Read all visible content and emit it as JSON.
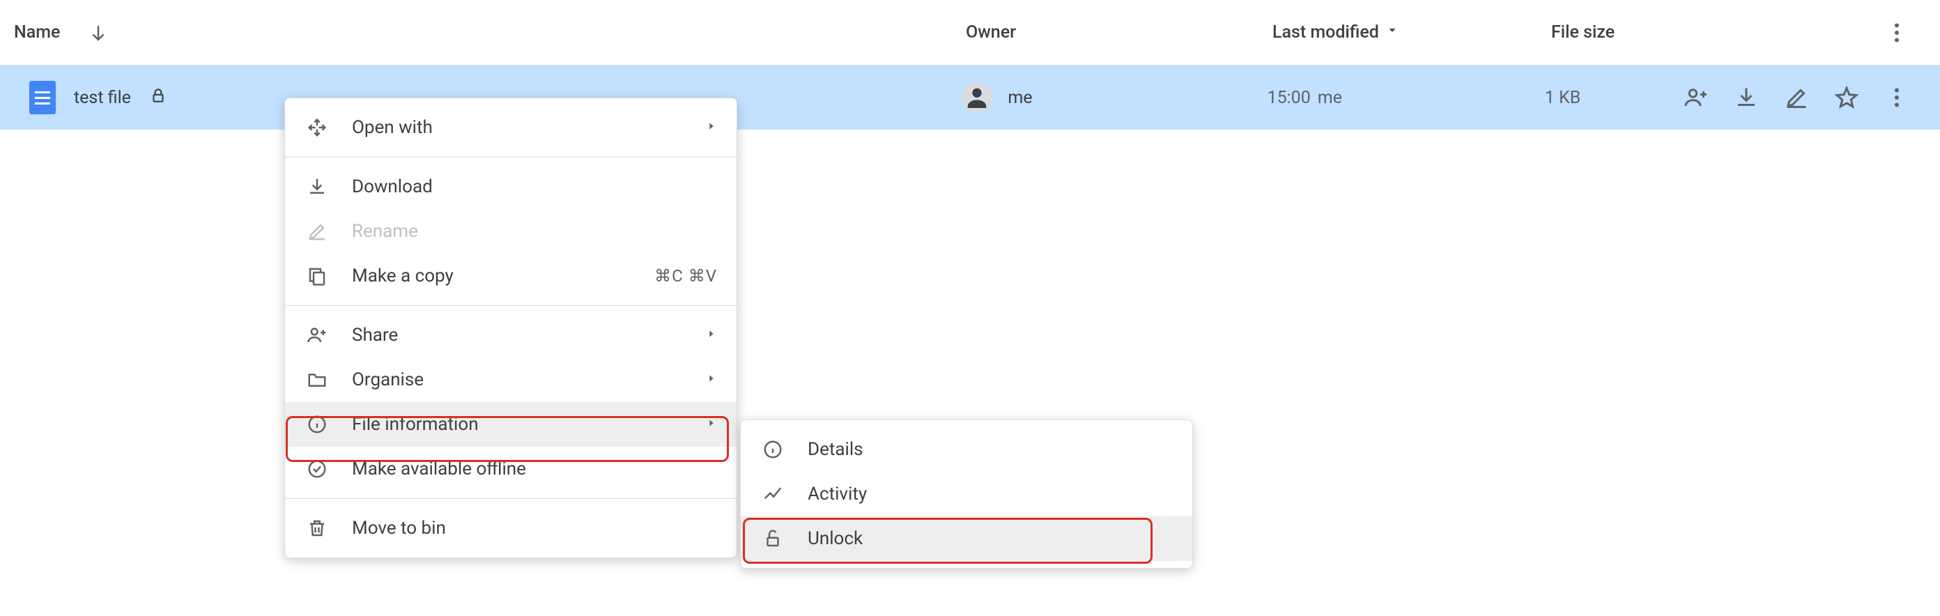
{
  "header": {
    "name": "Name",
    "owner": "Owner",
    "modified": "Last modified",
    "size": "File size"
  },
  "row": {
    "name": "test file",
    "owner": "me",
    "modified_time": "15:00",
    "modified_by": "me",
    "size": "1 KB"
  },
  "menu": {
    "open_with": "Open with",
    "download": "Download",
    "rename": "Rename",
    "make_copy": "Make a copy",
    "copy_shortcut": "⌘C ⌘V",
    "share": "Share",
    "organise": "Organise",
    "file_info": "File information",
    "offline": "Make available offline",
    "bin": "Move to bin"
  },
  "submenu": {
    "details": "Details",
    "activity": "Activity",
    "unlock": "Unlock"
  }
}
